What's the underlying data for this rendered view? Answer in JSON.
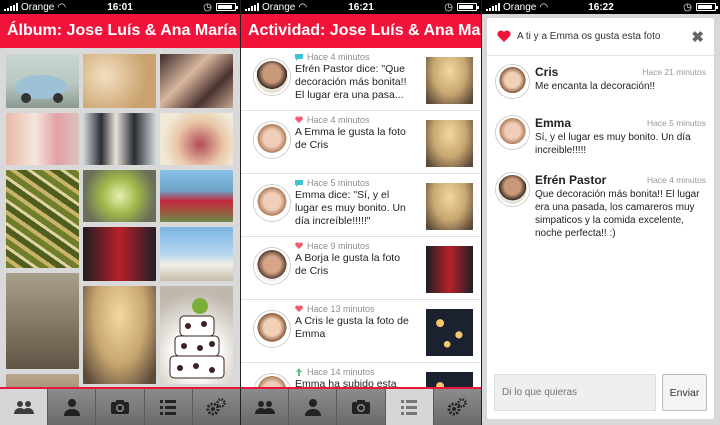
{
  "status": [
    {
      "carrier": "Orange",
      "time": "16:01"
    },
    {
      "carrier": "Orange",
      "time": "16:21"
    },
    {
      "carrier": "Orange",
      "time": "16:22"
    }
  ],
  "album": {
    "title": "Álbum: Jose Luís & Ana María"
  },
  "activity": {
    "title": "Actividad: Jose Luís & Ana Ma...",
    "items": [
      {
        "meta": "Hace 4 minutos",
        "type": "comment",
        "text": "Efrén Pastor dice: \"Que decoración más bonita!! El lugar era una pasa..."
      },
      {
        "meta": "Hace 4 minutos",
        "type": "like",
        "text": "A Emma le gusta la foto de Cris"
      },
      {
        "meta": "Hace 5 minutos",
        "type": "comment",
        "text": "Emma dice: \"Sí, y el lugar es muy bonito. Un día increíble!!!!!\""
      },
      {
        "meta": "Hace 9 minutos",
        "type": "like",
        "text": "A Borja le gusta la foto de Cris"
      },
      {
        "meta": "Hace 13 minutos",
        "type": "like",
        "text": "A Cris le gusta la foto de Emma"
      },
      {
        "meta": "Hace 14 minutos",
        "type": "upload",
        "text": "Emma ha subido esta"
      }
    ]
  },
  "comments": {
    "header": "A ti y a Emma os gusta esta foto",
    "items": [
      {
        "name": "Cris",
        "when": "Hace 21 minutos",
        "body": "Me encanta la decoración!!"
      },
      {
        "name": "Emma",
        "when": "Hace 5 minutos",
        "body": "Sí, y el lugar es muy bonito. Un día increible!!!!!"
      },
      {
        "name": "Efrén Pastor",
        "when": "Hace 4 minutos",
        "body": "Que decoración más bonita!! El lugar era una pasada, los camareros muy simpaticos y la comida excelente, noche perfecta!! :)"
      }
    ],
    "input_placeholder": "Di lo que quieras",
    "send_label": "Enviar"
  },
  "tabs": [
    "people-icon",
    "person-icon",
    "camera-icon",
    "list-icon",
    "gears-icon"
  ],
  "colors": {
    "accent": "#f2133b",
    "like": "#f25a6e",
    "comment": "#3ec3d8",
    "upload": "#5fbf7a"
  }
}
